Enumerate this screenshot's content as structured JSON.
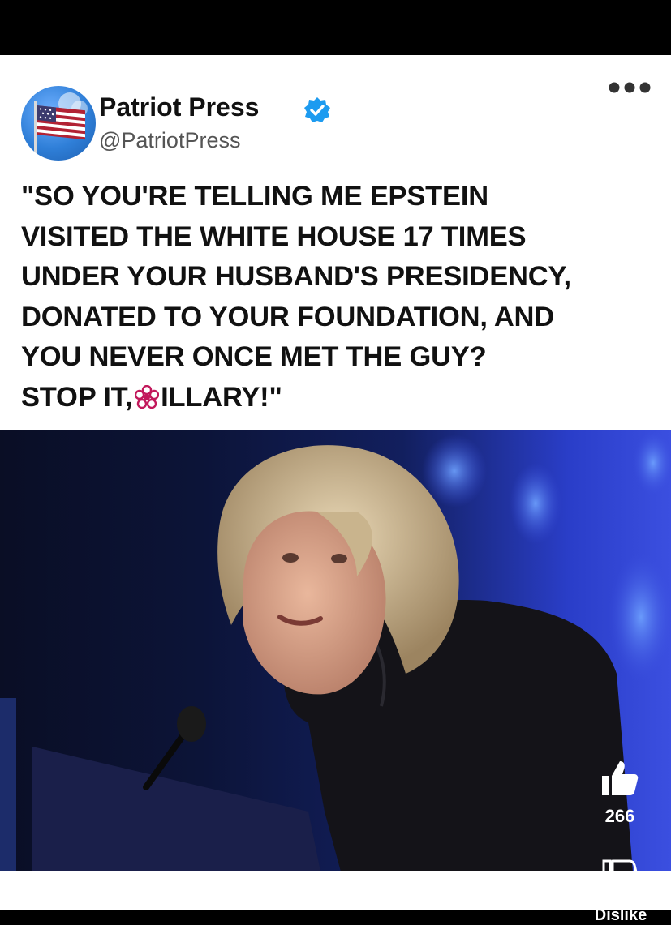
{
  "post": {
    "display_name": "Patriot Press",
    "handle": "@PatriotPress",
    "verified_icon": "verified-badge-icon",
    "more_icon": "more-options-icon",
    "quote_lines": [
      "\"SO YOU'RE TELLING ME EPSTEIN",
      "VISITED THE WHITE HOUSE 17 TIMES",
      "UNDER YOUR HUSBAND'S PRESIDENCY,",
      "DONATED TO YOUR FOUNDATION, AND",
      "YOU NEVER ONCE MET THE GUY?"
    ],
    "quote_last_prefix": "STOP IT,",
    "quote_last_suffix": "ILLARY!\"",
    "censor_icon": "pink-flower-icon"
  },
  "actions": {
    "like_icon": "thumbs-up-icon",
    "like_count": "266",
    "dislike_icon": "thumbs-down-icon",
    "dislike_label": "Dislike"
  },
  "colors": {
    "verified_blue": "#1d9bf0",
    "photo_background_blue": "#2a3ec9"
  }
}
